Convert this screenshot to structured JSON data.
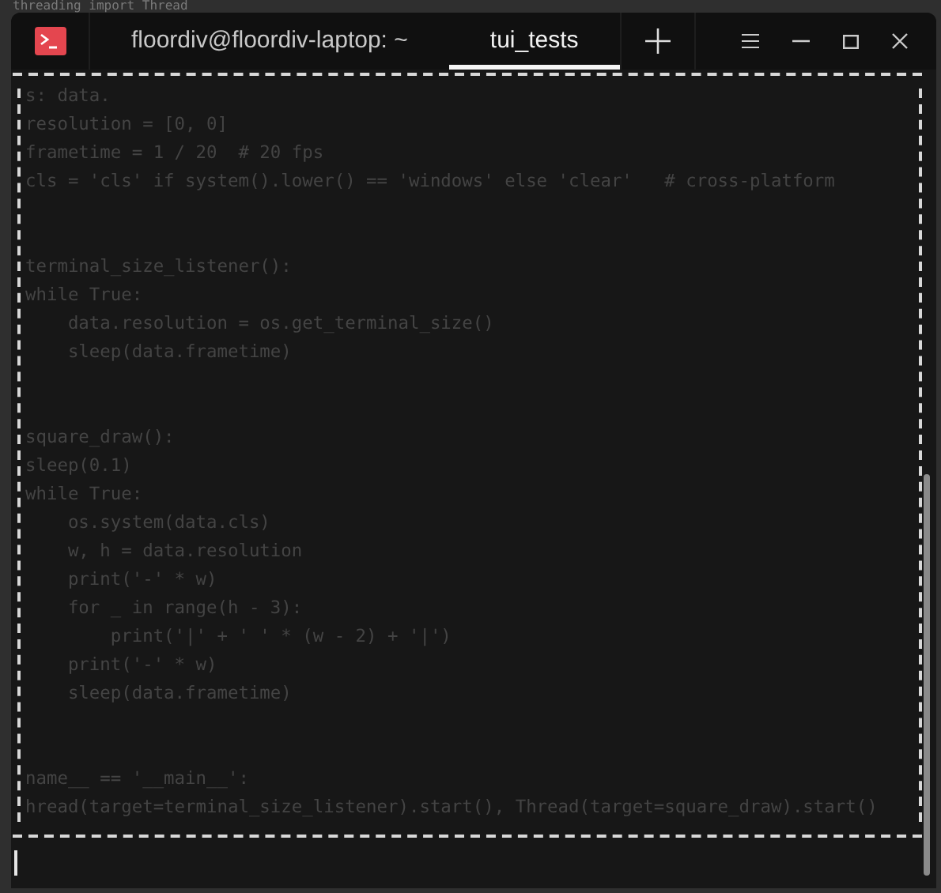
{
  "background_text": "threading import Thread",
  "window": {
    "tabs": [
      {
        "label": "floordiv@floordiv-laptop: ~",
        "selected": false
      },
      {
        "label": "tui_tests",
        "selected": true
      }
    ]
  },
  "code_blocks": [
    [
      "s: data.",
      "resolution = [0, 0]",
      "frametime = 1 / 20  # 20 fps",
      "cls = 'cls' if system().lower() == 'windows' else 'clear'   # cross-platform"
    ],
    [
      "terminal_size_listener():",
      "while True:",
      "    data.resolution = os.get_terminal_size()",
      "    sleep(data.frametime)"
    ],
    [
      "square_draw():",
      "sleep(0.1)",
      "while True:",
      "    os.system(data.cls)",
      "    w, h = data.resolution",
      "    print('-' * w)",
      "    for _ in range(h - 3):",
      "        print('|' + ' ' * (w - 2) + '|')",
      "    print('-' * w)",
      "    sleep(data.frametime)"
    ],
    [
      "name__ == '__main__':",
      "hread(target=terminal_size_listener).start(), Thread(target=square_draw).start()"
    ]
  ]
}
